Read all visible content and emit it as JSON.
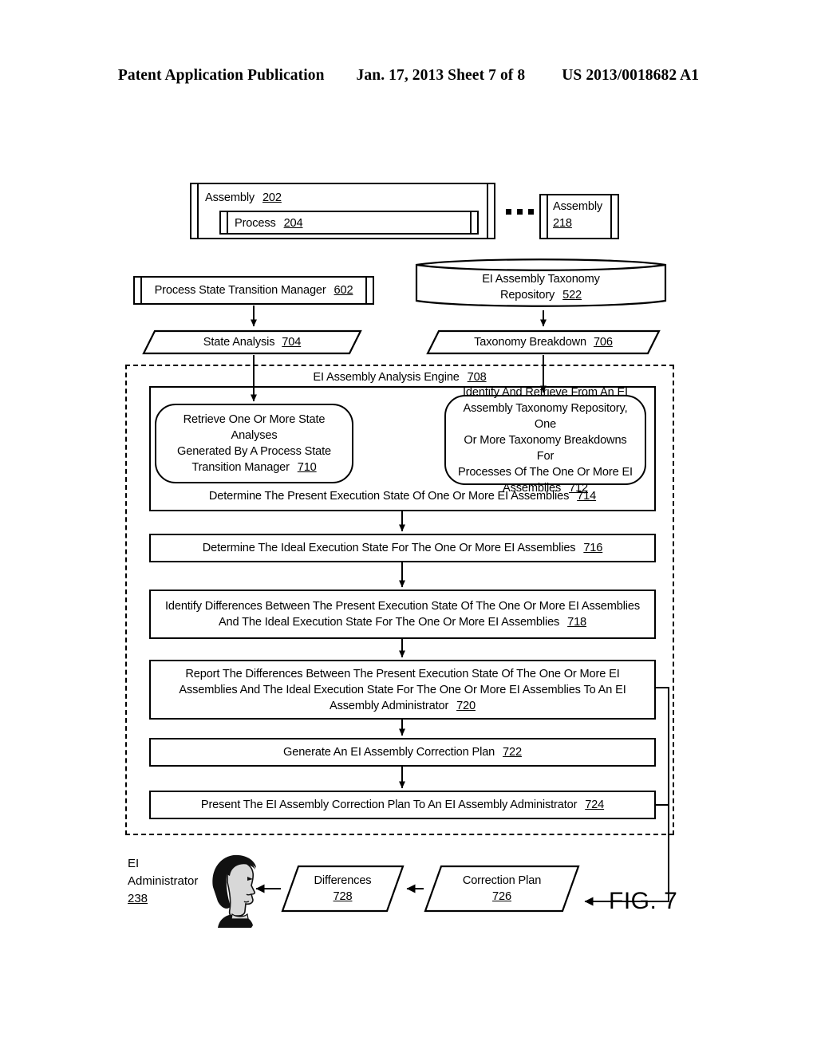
{
  "header": {
    "publication": "Patent Application Publication",
    "date_sheet": "Jan. 17, 2013  Sheet 7 of 8",
    "patent_number": "US 2013/0018682 A1"
  },
  "figure": {
    "caption": "FIG. 7"
  },
  "assemblies": {
    "assembly_202": {
      "label": "Assembly",
      "ref": "202"
    },
    "process_204": {
      "label": "Process",
      "ref": "204"
    },
    "assembly_218": {
      "label": "Assembly",
      "ref": "218"
    },
    "ellipsis": "• • •"
  },
  "sources": {
    "manager_602": {
      "label": "Process State Transition Manager",
      "ref": "602"
    },
    "repository_522": {
      "line1": "EI Assembly Taxonomy",
      "line2": "Repository",
      "ref": "522"
    }
  },
  "dataflows": {
    "state_analysis_704": {
      "label": "State Analysis",
      "ref": "704"
    },
    "taxonomy_breakdown_706": {
      "label": "Taxonomy Breakdown",
      "ref": "706"
    },
    "differences_728": {
      "label": "Differences",
      "ref": "728"
    },
    "correction_plan_726": {
      "line1": "Correction Plan",
      "ref": "726"
    }
  },
  "engine": {
    "title": "EI Assembly Analysis Engine",
    "ref": "708",
    "step_710": {
      "line1": "Retrieve One Or More State Analyses",
      "line2": "Generated By A Process State",
      "line3": "Transition Manager",
      "ref": "710"
    },
    "step_712": {
      "line1": "Identify And Retrieve From An EI",
      "line2": "Assembly Taxonomy Repository, One",
      "line3": "Or More Taxonomy Breakdowns For",
      "line4": "Processes Of The One Or More EI",
      "line5": "Assemblies",
      "ref": "712"
    },
    "step_714": {
      "line1": "Determine The Present Execution State Of One Or More EI Assemblies",
      "ref": "714"
    },
    "step_716": {
      "line1": "Determine The Ideal Execution State For The One Or More EI Assemblies",
      "ref": "716"
    },
    "step_718": {
      "line1": "Identify Differences Between The Present Execution State Of The One Or More EI Assemblies",
      "line2": "And The Ideal Execution State For The One Or More EI Assemblies",
      "ref": "718"
    },
    "step_720": {
      "line1": "Report The Differences Between The Present Execution State Of The One Or More EI",
      "line2": "Assemblies And The Ideal Execution State For The One Or More EI Assemblies To An EI",
      "line3": "Assembly Administrator",
      "ref": "720"
    },
    "step_722": {
      "line1": "Generate An EI Assembly Correction Plan",
      "ref": "722"
    },
    "step_724": {
      "line1": "Present The EI Assembly Correction Plan To An EI Assembly Administrator",
      "ref": "724"
    }
  },
  "actor": {
    "line1": "EI",
    "line2": "Administrator",
    "ref": "238"
  }
}
